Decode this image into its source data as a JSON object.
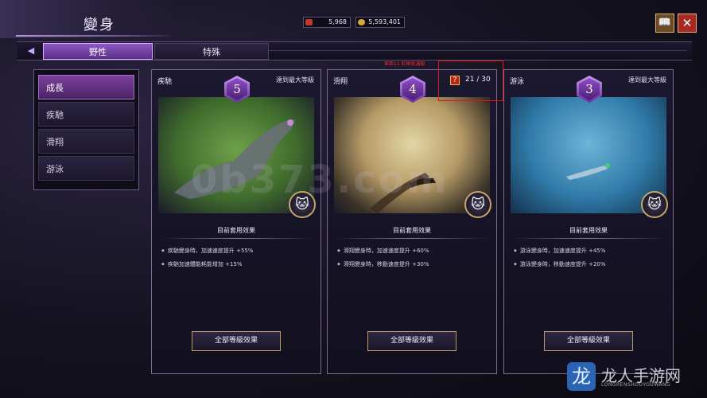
{
  "header": {
    "title": "變身"
  },
  "currency": [
    {
      "icon": "gem-icon",
      "value": "5,968",
      "color": "#c0392b"
    },
    {
      "icon": "coin-icon",
      "value": "5,593,401",
      "color": "#d4a83a"
    }
  ],
  "top_buttons": {
    "book": "📖",
    "close": "✕"
  },
  "tabs": [
    {
      "label": "野性",
      "active": true
    },
    {
      "label": "特殊",
      "active": false
    }
  ],
  "sidebar": {
    "items": [
      {
        "label": "成長",
        "active": true
      },
      {
        "label": "疾馳",
        "active": false
      },
      {
        "label": "滑翔",
        "active": false
      },
      {
        "label": "游泳",
        "active": false
      }
    ]
  },
  "cards": [
    {
      "name": "疾馳",
      "level": "5",
      "status": "達到最大等級",
      "effect_title": "目前套用效果",
      "effects": [
        "疾馳變身時，加速速度提升 +55%",
        "疾馳加速體能耗能增加 +15%"
      ],
      "button": "全部等級效果",
      "pet_icon": "🐱"
    },
    {
      "name": "滑翔",
      "level": "4",
      "status": "",
      "effect_title": "目前套用效果",
      "effects": [
        "滑翔變身時，加速速度提升 +60%",
        "滑翔變身時，移動速度提升 +30%"
      ],
      "button": "全部等級效果",
      "pet_icon": "🐱"
    },
    {
      "name": "游泳",
      "level": "3",
      "status": "達到最大等級",
      "effect_title": "目前套用效果",
      "effects": [
        "游泳變身時，加速速度提升 +45%",
        "游泳變身時，移動速度提升 +20%"
      ],
      "button": "全部等級效果",
      "pet_icon": "🐱"
    }
  ],
  "glide_progress": {
    "icon": "?",
    "current": "21",
    "separator": "/",
    "max": "30"
  },
  "annotation_note": "差距11 紅框就滿級",
  "watermark": "0b373.com",
  "corner_badge": {
    "icon": "龙",
    "title": "龙人手游网",
    "subtitle": "LONGRENSHOUYOUWANG"
  }
}
